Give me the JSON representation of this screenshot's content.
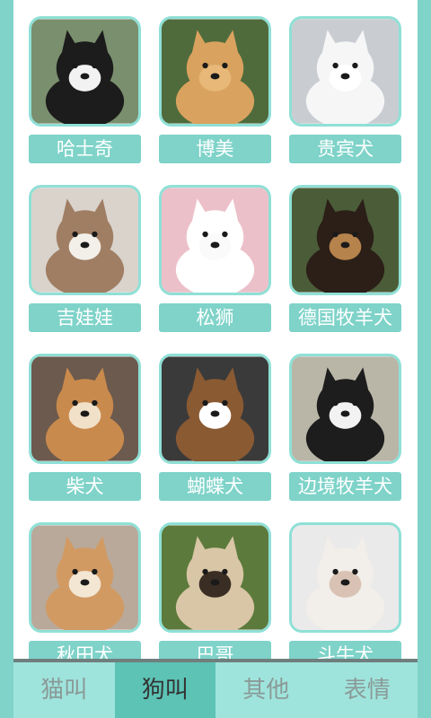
{
  "dogs": [
    {
      "label": "哈士奇",
      "colors": {
        "bg": "#7a8f6d",
        "fur": "#1c1c1c",
        "face": "#f2f2f2"
      }
    },
    {
      "label": "博美",
      "colors": {
        "bg": "#4f6b3c",
        "fur": "#d9a25f",
        "face": "#e7b878"
      }
    },
    {
      "label": "贵宾犬",
      "colors": {
        "bg": "#c9cdd2",
        "fur": "#f6f6f6",
        "face": "#ffffff"
      }
    },
    {
      "label": "吉娃娃",
      "colors": {
        "bg": "#d9d3cc",
        "fur": "#a07e63",
        "face": "#f3efe9"
      }
    },
    {
      "label": "松狮",
      "colors": {
        "bg": "#ecc0c9",
        "fur": "#ffffff",
        "face": "#fafafa"
      }
    },
    {
      "label": "德国牧羊犬",
      "colors": {
        "bg": "#4b5d38",
        "fur": "#2b1f17",
        "face": "#b7834c"
      }
    },
    {
      "label": "柴犬",
      "colors": {
        "bg": "#6b5a4d",
        "fur": "#c98a4d",
        "face": "#f1e1c9"
      }
    },
    {
      "label": "蝴蝶犬",
      "colors": {
        "bg": "#3a3a3a",
        "fur": "#8a5a33",
        "face": "#ffffff"
      }
    },
    {
      "label": "边境牧羊犬",
      "colors": {
        "bg": "#b9b6a8",
        "fur": "#1d1d1d",
        "face": "#f2f2f2"
      }
    },
    {
      "label": "秋田犬",
      "colors": {
        "bg": "#b8a99a",
        "fur": "#d29a63",
        "face": "#f3e6d3"
      }
    },
    {
      "label": "巴哥",
      "colors": {
        "bg": "#5c7a3b",
        "fur": "#d8c6a6",
        "face": "#3a2d24"
      }
    },
    {
      "label": "斗牛犬",
      "colors": {
        "bg": "#eaeaea",
        "fur": "#f2eee9",
        "face": "#d9c2b3"
      }
    }
  ],
  "tabs": [
    {
      "label": "猫叫",
      "active": false
    },
    {
      "label": "狗叫",
      "active": true
    },
    {
      "label": "其他",
      "active": false
    },
    {
      "label": "表情",
      "active": false
    }
  ],
  "theme": {
    "accent": "#7fd3c9",
    "active_tab": "#5cc3b5",
    "border": "#8fe0d6"
  }
}
